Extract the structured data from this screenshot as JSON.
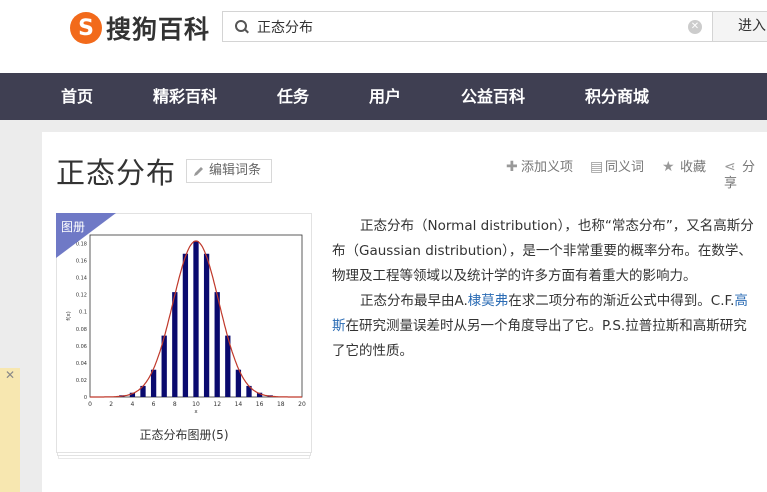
{
  "header": {
    "logo_mark": "S",
    "logo_text": "搜狗百科",
    "search_value": "正态分布",
    "enter_label": "进入"
  },
  "nav": {
    "items": [
      "首页",
      "精彩百科",
      "任务",
      "用户",
      "公益百科",
      "积分商城"
    ]
  },
  "entry": {
    "title": "正态分布",
    "edit_label": "编辑词条",
    "actions": {
      "add_meaning": "添加义项",
      "synonym": "同义词",
      "favorite": "收藏",
      "share": "分享"
    }
  },
  "album": {
    "badge": "图册",
    "caption": "正态分布图册(5)"
  },
  "paragraphs": {
    "p1_line1": "正态分布（Normal distribution），也称“常态分布”，又名高斯分",
    "p1_line2": "布（Gaussian distribution），是一个非常重要的概率分布。在数学、",
    "p1_line3": "物理及工程等领域以及统计学的许多方面有着重大的影响力。",
    "p2_line1_a": "正态分布最早由A.",
    "p2_line1_link": "棣莫弗",
    "p2_line1_b": "在求二项分布的渐近公式中得到。C.F.",
    "p2_line1_link2": "高",
    "p2_line2_link": "斯",
    "p2_line2_b": "在研究测量误差时从另一个角度导出了它。P.S.拉普拉斯和高斯研究",
    "p2_line3": "了它的性质。"
  },
  "chart_data": {
    "type": "bar",
    "x": [
      1,
      2,
      3,
      4,
      5,
      6,
      7,
      8,
      9,
      10,
      11,
      12,
      13,
      14,
      15,
      16,
      17,
      18,
      19
    ],
    "values": [
      0.0,
      0.0,
      0.002,
      0.005,
      0.013,
      0.032,
      0.072,
      0.123,
      0.168,
      0.183,
      0.168,
      0.123,
      0.072,
      0.032,
      0.013,
      0.005,
      0.002,
      0.0,
      0.0
    ],
    "xlabel": "x",
    "ylabel": "f(x)",
    "xlim": [
      0,
      20
    ],
    "ylim": [
      0,
      0.19
    ],
    "xticks": [
      "0",
      "2",
      "4",
      "6",
      "8",
      "10",
      "12",
      "14",
      "16",
      "18",
      "20"
    ],
    "yticks": [
      "0",
      "0.02",
      "0.04",
      "0.06",
      "0.08",
      "0.1",
      "0.12",
      "0.14",
      "0.16",
      "0.18"
    ],
    "bar_color": "#0a0a6e",
    "curve_color": "#c0392b"
  }
}
